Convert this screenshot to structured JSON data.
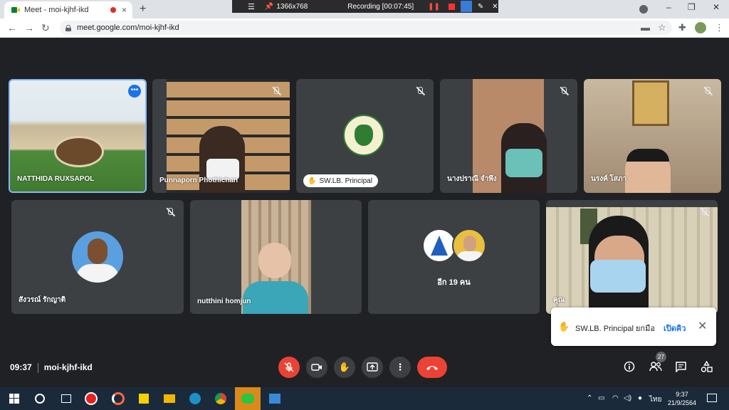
{
  "browser": {
    "tab_title": "Meet - moi-kjhf-ikd",
    "tab_close": "×",
    "new_tab": "+",
    "url": "meet.google.com/moi-kjhf-ikd",
    "nav_back": "←",
    "nav_forward": "→",
    "nav_reload": "↻",
    "win_min": "–",
    "win_max": "❐",
    "win_close": "✕",
    "menu_glyph": "⋮"
  },
  "recorder": {
    "resolution": "1366x768",
    "status": "Recording [00:07:45]"
  },
  "participants": [
    {
      "name": "NATTHIDA RUXSAPOL",
      "pinned": true
    },
    {
      "name": "Punnaporn Phothichan"
    },
    {
      "name": "SW.LB. Principal",
      "avatar": "school-logo"
    },
    {
      "name": "นางปราณี จำพึง"
    },
    {
      "name": "นรงค์ โสภา"
    },
    {
      "name": "สังวรณ์ รักญาติ",
      "avatar": "photo"
    },
    {
      "name": "nutthini homjun"
    },
    {
      "name": "อีก 19 คน"
    },
    {
      "name": "คุณ"
    }
  ],
  "toast": {
    "message": "SW.LB. Principal ยกมือ",
    "action": "เปิดคิว",
    "close": "✕"
  },
  "meeting": {
    "time": "09:37",
    "code": "moi-kjhf-ikd",
    "people_count": "27"
  },
  "controls": {
    "mic": "mic-off",
    "camera": "camera",
    "hand": "raise-hand",
    "present": "present",
    "more": "more",
    "end": "end-call"
  },
  "taskbar": {
    "time": "9:37",
    "date": "21/9/2564",
    "lang": "ไทย"
  },
  "colors": {
    "meet_bg": "#202124",
    "tile_bg": "#3c4043",
    "end_red": "#ea4335",
    "link_blue": "#1a73e8",
    "pin_border": "#8ab4f8"
  }
}
